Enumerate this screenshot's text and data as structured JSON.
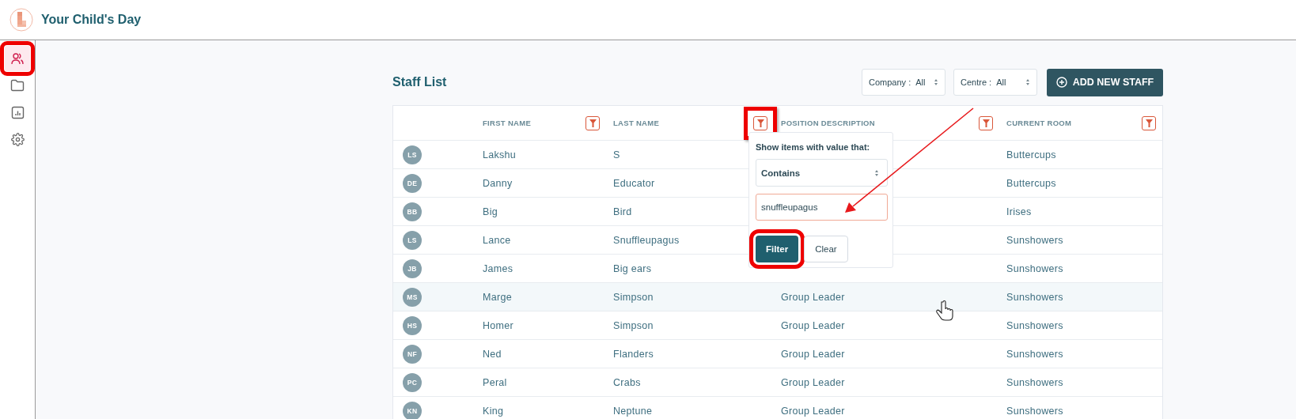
{
  "app": {
    "title": "Your Child's Day"
  },
  "sidebar": {
    "items": [
      {
        "selected": true,
        "highlighted": true
      },
      {
        "selected": false,
        "highlighted": false
      },
      {
        "selected": false,
        "highlighted": false
      },
      {
        "selected": false,
        "highlighted": false
      }
    ]
  },
  "page": {
    "title": "Staff List",
    "filters": [
      {
        "label": "Company :",
        "value": "All"
      },
      {
        "label": "Centre :",
        "value": "All"
      }
    ],
    "add_button": "ADD NEW STAFF"
  },
  "table": {
    "columns": [
      {
        "label": "FIRST NAME",
        "filter_highlighted": false
      },
      {
        "label": "LAST NAME",
        "filter_highlighted": true
      },
      {
        "label": "POSITION DESCRIPTION",
        "filter_highlighted": false
      },
      {
        "label": "CURRENT ROOM",
        "filter_highlighted": false
      }
    ],
    "rows": [
      {
        "initials": "LS",
        "first": "Lakshu",
        "last": "S",
        "room": "Buttercups",
        "hovered": false
      },
      {
        "initials": "DE",
        "first": "Danny",
        "last": "Educator",
        "room": "Buttercups",
        "hovered": false
      },
      {
        "initials": "BB",
        "first": "Big",
        "last": "Bird",
        "room": "Irises",
        "hovered": false
      },
      {
        "initials": "LS",
        "first": "Lance",
        "last": "Snuffleupagus",
        "room": "Sunshowers",
        "hovered": false
      },
      {
        "initials": "JB",
        "first": "James",
        "last": "Big ears",
        "room": "Sunshowers",
        "hovered": false
      },
      {
        "initials": "MS",
        "first": "Marge",
        "last": "Simpson",
        "position": "Group Leader",
        "room": "Sunshowers",
        "hovered": true
      },
      {
        "initials": "HS",
        "first": "Homer",
        "last": "Simpson",
        "position": "Group Leader",
        "room": "Sunshowers",
        "hovered": false
      },
      {
        "initials": "NF",
        "first": "Ned",
        "last": "Flanders",
        "position": "Group Leader",
        "room": "Sunshowers",
        "hovered": false
      },
      {
        "initials": "PC",
        "first": "Peral",
        "last": "Crabs",
        "position": "Group Leader",
        "room": "Sunshowers",
        "hovered": false
      },
      {
        "initials": "KN",
        "first": "King",
        "last": "Neptune",
        "position": "Group Leader",
        "room": "Sunshowers",
        "hovered": false
      }
    ]
  },
  "filter_popup": {
    "label": "Show items with value that:",
    "operator": "Contains",
    "value": "snuffleupagus",
    "buttons": [
      {
        "label": "Filter",
        "kind": "primary",
        "highlighted": true
      },
      {
        "label": "Clear",
        "kind": "secondary",
        "highlighted": false
      }
    ]
  }
}
